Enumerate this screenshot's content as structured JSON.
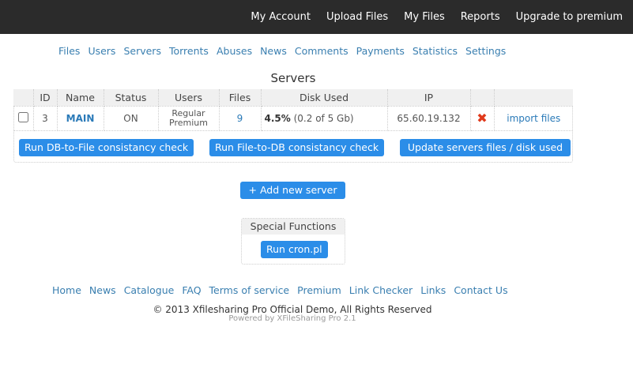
{
  "topnav": [
    "My Account",
    "Upload Files",
    "My Files",
    "Reports",
    "Upgrade to premium"
  ],
  "adminnav": [
    "Files",
    "Users",
    "Servers",
    "Torrents",
    "Abuses",
    "News",
    "Comments",
    "Payments",
    "Statistics",
    "Settings"
  ],
  "title": "Servers",
  "table": {
    "headers": [
      "",
      "ID",
      "Name",
      "Status",
      "Users",
      "Files",
      "Disk Used",
      "IP",
      "",
      ""
    ],
    "row": {
      "id": "3",
      "name": "MAIN",
      "status": "ON",
      "users1": "Regular",
      "users2": "Premium",
      "files": "9",
      "disk_pct": "4.5%",
      "disk_detail": "(0.2 of 5 Gb)",
      "ip": "65.60.19.132",
      "action": "import files"
    }
  },
  "buttons": {
    "db_to_file": "Run DB-to-File consistancy check",
    "file_to_db": "Run File-to-DB consistancy check",
    "update": "Update servers files / disk used",
    "add": "+ Add new server",
    "cron": "Run cron.pl"
  },
  "special_title": "Special Functions",
  "footnav": [
    "Home",
    "News",
    "Catalogue",
    "FAQ",
    "Terms of service",
    "Premium",
    "Link Checker",
    "Links",
    "Contact Us"
  ],
  "copyright": "© 2013 Xfilesharing Pro Official Demo, All Rights Reserved",
  "powered": "Powered by XFileSharing Pro 2.1"
}
